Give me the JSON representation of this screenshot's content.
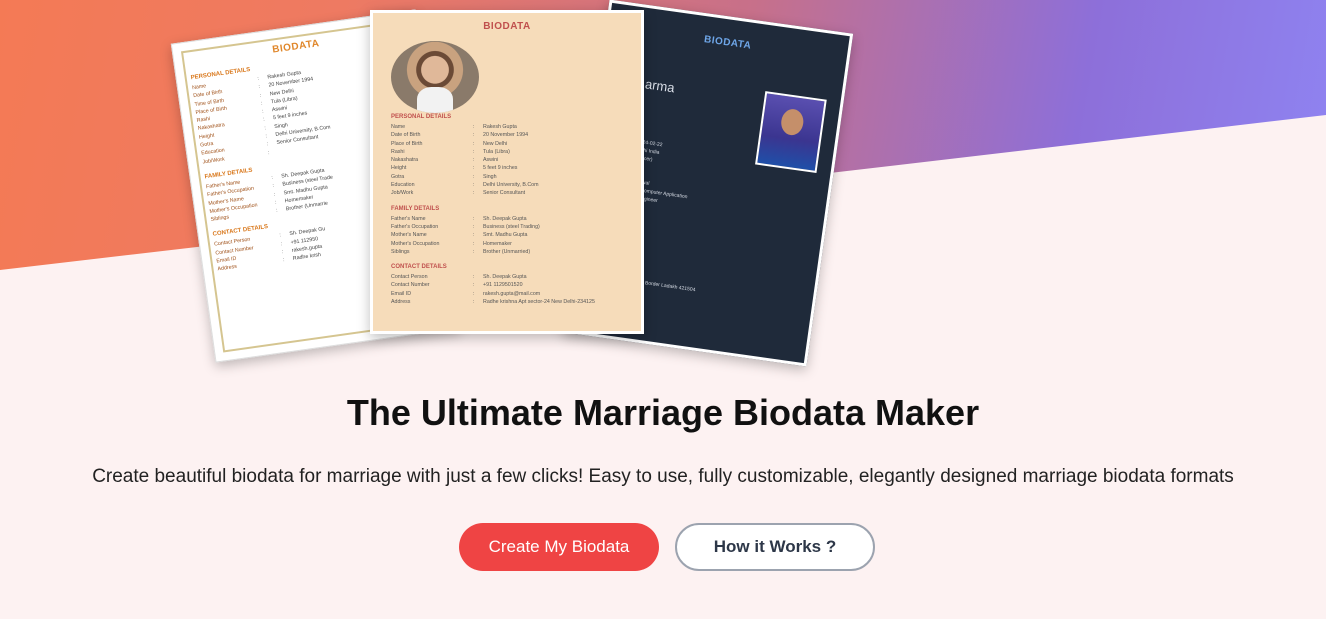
{
  "hero": {
    "title": "The Ultimate Marriage Biodata Maker",
    "subtitle": "Create beautiful biodata for marriage with just a few clicks! Easy to use, fully customizable, elegantly designed marriage biodata formats",
    "primary_button": "Create My Biodata",
    "secondary_button": "How it Works ?"
  },
  "colors": {
    "primary": "#ef4444",
    "background": "#fdf2f2",
    "gradient_start": "#f47a55",
    "gradient_end": "#8f84f2"
  },
  "card_left": {
    "title": "BIODATA",
    "personal_heading": "PERSONAL DETAILS",
    "personal": [
      {
        "k": "Name",
        "v": "Rakesh Gupta"
      },
      {
        "k": "Date of Birth",
        "v": "20 November 1994"
      },
      {
        "k": "Time of Birth",
        "v": "New Delhi"
      },
      {
        "k": "Place of Birth",
        "v": "Tula (Libra)"
      },
      {
        "k": "Rashi",
        "v": "Aswini"
      },
      {
        "k": "Nakashatra",
        "v": "5 feet 9 inches"
      },
      {
        "k": "Height",
        "v": "Singh"
      },
      {
        "k": "Gotra",
        "v": "Delhi University, B.Com"
      },
      {
        "k": "Education",
        "v": "Senior Consultant"
      },
      {
        "k": "Job/Work",
        "v": ""
      }
    ],
    "family_heading": "FAMILY DETAILS",
    "family": [
      {
        "k": "Father's Name",
        "v": "Sh. Deepak Gupta"
      },
      {
        "k": "Father's Occupation",
        "v": "Business (steel Trade"
      },
      {
        "k": "Mother's Name",
        "v": "Smt. Madhu Gupta"
      },
      {
        "k": "Mother's Occupation",
        "v": "Homemaker"
      },
      {
        "k": "Siblings",
        "v": "Brother (Unmarrie"
      }
    ],
    "contact_heading": "CONTACT DETAILS",
    "contact": [
      {
        "k": "Contact Person",
        "v": "Sh. Deepak Gu"
      },
      {
        "k": "Contact Number",
        "v": "+91 112950"
      },
      {
        "k": "Email ID",
        "v": "rakesh.gupta"
      },
      {
        "k": "Address",
        "v": "Radhe krish"
      }
    ]
  },
  "card_center": {
    "title": "BIODATA",
    "personal_heading": "PERSONAL DETAILS",
    "personal": [
      {
        "k": "Name",
        "v": "Rakesh Gupta"
      },
      {
        "k": "Date of Birth",
        "v": "20 November 1994"
      },
      {
        "k": "Place of Birth",
        "v": "New Delhi"
      },
      {
        "k": "Rashi",
        "v": "Tula (Libra)"
      },
      {
        "k": "Nakashatra",
        "v": "Aswini"
      },
      {
        "k": "Height",
        "v": "5 feet 9 inches"
      },
      {
        "k": "Gotra",
        "v": "Singh"
      },
      {
        "k": "Education",
        "v": "Delhi University, B.Com"
      },
      {
        "k": "Job/Work",
        "v": "Senior Consultant"
      }
    ],
    "family_heading": "FAMILY DETAILS",
    "family": [
      {
        "k": "Father's Name",
        "v": "Sh. Deepak Gupta"
      },
      {
        "k": "Father's Occupation",
        "v": "Business (steel Trading)"
      },
      {
        "k": "Mother's Name",
        "v": "Smt. Madhu Gupta"
      },
      {
        "k": "Mother's Occupation",
        "v": "Homemaker"
      },
      {
        "k": "Siblings",
        "v": "Brother (Unmarried)"
      }
    ],
    "contact_heading": "CONTACT DETAILS",
    "contact": [
      {
        "k": "Contact Person",
        "v": "Sh. Deepak Gupta"
      },
      {
        "k": "Contact Number",
        "v": "+91 1129501520"
      },
      {
        "k": "Email ID",
        "v": "rakesh.gupta@mail.com"
      },
      {
        "k": "Address",
        "v": "Radhe krishna Apt sector-24 New Delhi-234125"
      }
    ]
  },
  "card_right": {
    "title": "BIODATA",
    "name_fragment": "arma",
    "lines": [
      "2024-02-22",
      "Delhi India",
      "Cancer)",
      "shita",
      "feet",
      "Agarwal",
      "or in computer Application",
      "are Engineer"
    ],
    "footer": "and Jammu Border Ladakh 421504"
  }
}
